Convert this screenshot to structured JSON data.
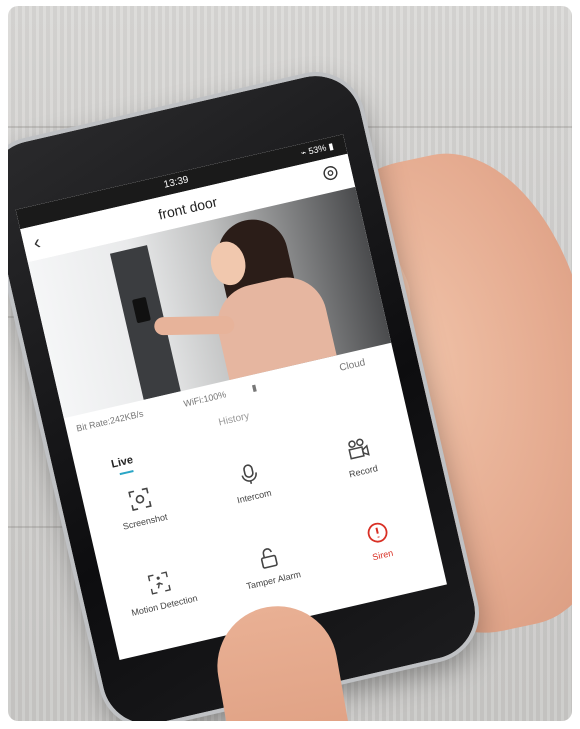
{
  "phone": {
    "status": {
      "time": "13:39",
      "battery": "⌁ 53% ▮"
    },
    "nav": {
      "title": "front door",
      "back_glyph": "‹"
    },
    "info": {
      "bit_rate": "Bit Rate:242KB/s",
      "wifi": "WiFi:100%",
      "cloud": "Cloud"
    },
    "tabs": {
      "history": "History",
      "live": "Live"
    },
    "grid": [
      {
        "label": "Screenshot",
        "icon": "screenshot-icon"
      },
      {
        "label": "Intercom",
        "icon": "microphone-icon"
      },
      {
        "label": "Record",
        "icon": "camera-record-icon"
      },
      {
        "label": "Motion Detection",
        "icon": "motion-icon"
      },
      {
        "label": "Tamper Alarm",
        "icon": "unlock-icon"
      },
      {
        "label": "Siren",
        "icon": "alert-icon"
      }
    ],
    "page_dots": "● ●"
  },
  "colors": {
    "accent": "#2aa6c6",
    "alert": "#d93025"
  }
}
